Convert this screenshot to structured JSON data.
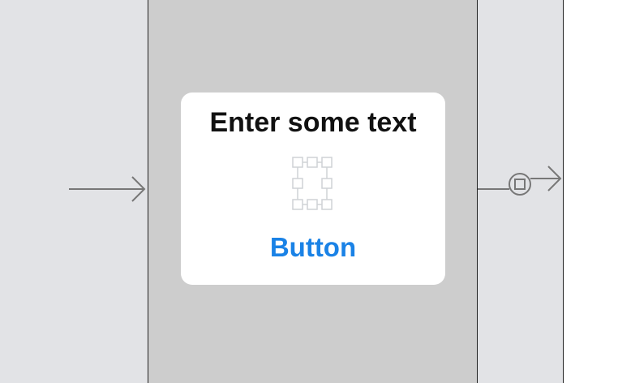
{
  "scene": {
    "label_text": "Enter some text",
    "button_label": "Button"
  },
  "colors": {
    "accent": "#1a82e6",
    "scene_bg": "#cdcdcd",
    "canvas_bg": "#e2e3e6"
  },
  "icons": [
    "entry-arrow-icon",
    "stack-view-placeholder-icon",
    "segue-icon"
  ]
}
